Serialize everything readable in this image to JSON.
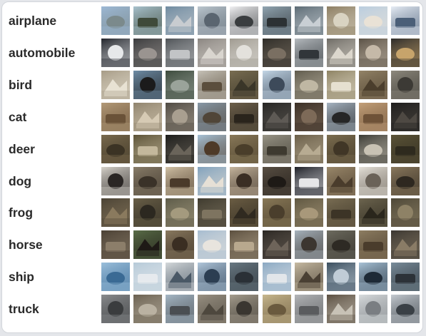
{
  "grid": {
    "images_per_class": 10,
    "classes": [
      {
        "label": "airplane",
        "thumb_colors": [
          [
            "#9db9d6",
            "#7b8a8c"
          ],
          [
            "#a9c3cf",
            "#3f4a3a"
          ],
          [
            "#6e8aa0",
            "#c8ccd0"
          ],
          [
            "#bcc7cf",
            "#5a6570"
          ],
          [
            "#f3f3f5",
            "#3a3d3f"
          ],
          [
            "#93a7b4",
            "#2c3134"
          ],
          [
            "#5b6a74",
            "#c9cfd4"
          ],
          [
            "#8c7d62",
            "#d9d3c2"
          ],
          [
            "#b9cde0",
            "#e9e2d6"
          ],
          [
            "#e8eef6",
            "#4b5f78"
          ]
        ]
      },
      {
        "label": "automobile",
        "thumb_colors": [
          [
            "#20232a",
            "#e6e8ea"
          ],
          [
            "#3a3b3d",
            "#9a9490"
          ],
          [
            "#4e5256",
            "#c2c4c6"
          ],
          [
            "#8a8580",
            "#d9d5cf"
          ],
          [
            "#9f9a90",
            "#e3e1dc"
          ],
          [
            "#2e2c27",
            "#7a6f62"
          ],
          [
            "#b7bcc0",
            "#31363a"
          ],
          [
            "#6d6a64",
            "#dcd7cd"
          ],
          [
            "#5a5145",
            "#c5b9a8"
          ],
          [
            "#2b2a29",
            "#c7a46b"
          ]
        ]
      },
      {
        "label": "bird",
        "thumb_colors": [
          [
            "#a69b86",
            "#e8e2d3"
          ],
          [
            "#6f8ea8",
            "#1b1b1b"
          ],
          [
            "#3c4a3c",
            "#9aa39a"
          ],
          [
            "#c7c3b9",
            "#5b4e3d"
          ],
          [
            "#7a6e52",
            "#3a3628"
          ],
          [
            "#c5d8e8",
            "#3d4a5a"
          ],
          [
            "#5f5a4c",
            "#bfb7a3"
          ],
          [
            "#8d8262",
            "#e6e0d0"
          ],
          [
            "#948468",
            "#4b3e2c"
          ],
          [
            "#8e8a7e",
            "#3c3a35"
          ]
        ]
      },
      {
        "label": "cat",
        "thumb_colors": [
          [
            "#b39a78",
            "#6a5238"
          ],
          [
            "#8f836d",
            "#d6cab4"
          ],
          [
            "#4f4a43",
            "#a99f90"
          ],
          [
            "#8899a8",
            "#504538"
          ],
          [
            "#6e614c",
            "#2a241c"
          ],
          [
            "#262523",
            "#5e5a55"
          ],
          [
            "#3a2f26",
            "#7d6a58"
          ],
          [
            "#a8b6c4",
            "#262626"
          ],
          [
            "#c4a17a",
            "#6e5238"
          ],
          [
            "#1e1d1c",
            "#4e4943"
          ]
        ]
      },
      {
        "label": "deer",
        "thumb_colors": [
          [
            "#7a6b4e",
            "#3b3324"
          ],
          [
            "#5b5236",
            "#c3b89c"
          ],
          [
            "#1c1c1a",
            "#6a645a"
          ],
          [
            "#a8c3d8",
            "#4e3a28"
          ],
          [
            "#8a7a5a",
            "#4a3e2a"
          ],
          [
            "#9a9688",
            "#3e3a30"
          ],
          [
            "#6a5e48",
            "#b7ab92"
          ],
          [
            "#7c6e50",
            "#403626"
          ],
          [
            "#3a3a34",
            "#c8c2b4"
          ],
          [
            "#5c5438",
            "#2e2a1e"
          ]
        ]
      },
      {
        "label": "dog",
        "thumb_colors": [
          [
            "#d8d4cc",
            "#2a2624"
          ],
          [
            "#8a7e6a",
            "#3a3228"
          ],
          [
            "#d2c2a6",
            "#4a3a2a"
          ],
          [
            "#7fa0bc",
            "#e6e0d6"
          ],
          [
            "#c8b8a0",
            "#3a2e24"
          ],
          [
            "#5a5044",
            "#1e1a16"
          ],
          [
            "#1a1c24",
            "#e6e6e8"
          ],
          [
            "#9c8a6c",
            "#4a3c2c"
          ],
          [
            "#e6e2da",
            "#6a6258"
          ],
          [
            "#8c7a5e",
            "#2e2820"
          ]
        ]
      },
      {
        "label": "frog",
        "thumb_colors": [
          [
            "#4a4234",
            "#8a7a5e"
          ],
          [
            "#6a6048",
            "#2c2820"
          ],
          [
            "#5c5a48",
            "#a49a7e"
          ],
          [
            "#3e3a2e",
            "#7e7460"
          ],
          [
            "#6c5e44",
            "#302a20"
          ],
          [
            "#8a7a58",
            "#4a3e2c"
          ],
          [
            "#5e5640",
            "#a8987a"
          ],
          [
            "#7a6e54",
            "#3c3426"
          ],
          [
            "#6e6650",
            "#2a261c"
          ],
          [
            "#4c4636",
            "#8e8266"
          ]
        ]
      },
      {
        "label": "horse",
        "thumb_colors": [
          [
            "#4a4034",
            "#8c7e6a"
          ],
          [
            "#5a6e48",
            "#1e1a16"
          ],
          [
            "#8a7a60",
            "#3a2e22"
          ],
          [
            "#a6bcd0",
            "#e8e4de"
          ],
          [
            "#5a4e3e",
            "#b8a88e"
          ],
          [
            "#2a2622",
            "#6e645a"
          ],
          [
            "#a8b4be",
            "#3c3630"
          ],
          [
            "#6e6c60",
            "#2e2a24"
          ],
          [
            "#8e7e62",
            "#4a3c2c"
          ],
          [
            "#3a3630",
            "#8a7c66"
          ]
        ]
      },
      {
        "label": "ship",
        "thumb_colors": [
          [
            "#9cc0dc",
            "#3a6a94"
          ],
          [
            "#b6cad8",
            "#e6eaee"
          ],
          [
            "#d6dadc",
            "#4a5866"
          ],
          [
            "#b2c8dc",
            "#2c3e52"
          ],
          [
            "#6a7a84",
            "#2a3036"
          ],
          [
            "#8aa8c2",
            "#e2e6ea"
          ],
          [
            "#c8bca4",
            "#4a4034"
          ],
          [
            "#3a4e5e",
            "#c0ccd6"
          ],
          [
            "#aac4d8",
            "#1e2a36"
          ],
          [
            "#7a8e9c",
            "#2c3238"
          ]
        ]
      },
      {
        "label": "truck",
        "thumb_colors": [
          [
            "#8a8c8e",
            "#3a3c3e"
          ],
          [
            "#6a6050",
            "#bab2a2"
          ],
          [
            "#a6b8c6",
            "#4a4e52"
          ],
          [
            "#9a9284",
            "#4e483e"
          ],
          [
            "#a69e8e",
            "#3a3630"
          ],
          [
            "#c8b88e",
            "#6a5a3e"
          ],
          [
            "#b4b6b8",
            "#5a5c5e"
          ],
          [
            "#5a4e40",
            "#c8c2b6"
          ],
          [
            "#d8dcde",
            "#7a7e82"
          ],
          [
            "#c6ccd2",
            "#3a4046"
          ]
        ]
      }
    ]
  }
}
